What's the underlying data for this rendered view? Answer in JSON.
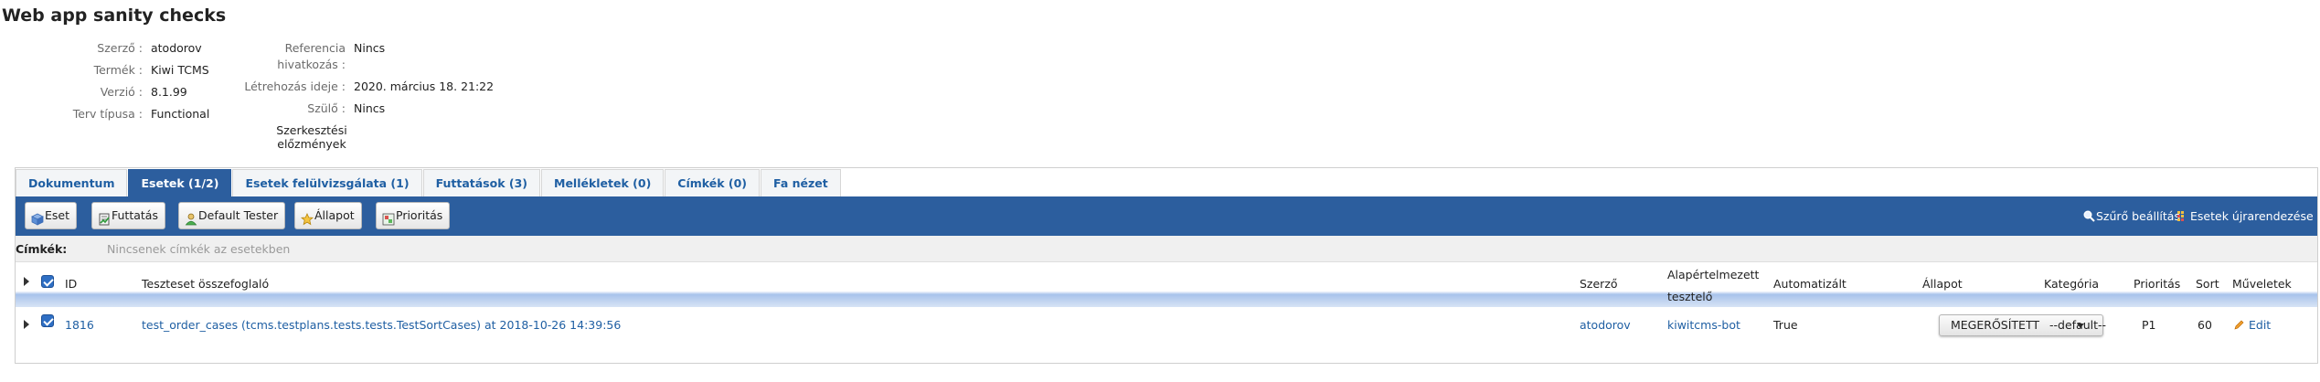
{
  "plan": {
    "title": "Web app sanity checks"
  },
  "meta": {
    "author_label": "Szerző :",
    "author_value": "atodorov",
    "product_label": "Termék :",
    "product_value": "Kiwi TCMS",
    "version_label": "Verzió :",
    "version_value": "8.1.99",
    "plan_type_label": "Terv típusa :",
    "plan_type_value": "Functional",
    "reference_label_1": "Referencia",
    "reference_label_2": "hivatkozás :",
    "reference_value": "Nincs",
    "created_label": "Létrehozás ideje :",
    "created_value": "2020. március 18. 21:22",
    "parent_label": "Szülő :",
    "parent_value": "Nincs",
    "history_link_1": "Szerkesztési",
    "history_link_2": "előzmények"
  },
  "tabs": [
    {
      "label": "Dokumentum",
      "active": false
    },
    {
      "label": "Esetek (1/2)",
      "active": true
    },
    {
      "label": "Esetek felülvizsgálata (1)",
      "active": false
    },
    {
      "label": "Futtatások (3)",
      "active": false
    },
    {
      "label": "Mellékletek (0)",
      "active": false
    },
    {
      "label": "Címkék (0)",
      "active": false
    },
    {
      "label": "Fa nézet",
      "active": false
    }
  ],
  "toolbar": {
    "case_button": "Eset",
    "run_button": "Futtatás",
    "tester_button": "Default Tester",
    "status_button": "Állapot",
    "priority_button": "Prioritás",
    "filter_link": "Szűrő beállítás",
    "reorder_link": "Esetek újrarendezése"
  },
  "tags": {
    "label": "Címkék:",
    "empty_text": "Nincsenek címkék az esetekben"
  },
  "table": {
    "headers": {
      "id": "ID",
      "summary": "Teszteset összefoglaló",
      "author": "Szerző",
      "default_tester_1": "Alapértelmezett",
      "default_tester_2": "tesztelő",
      "automated": "Automatizált",
      "status": "Állapot",
      "category": "Kategória",
      "priority": "Prioritás",
      "sort": "Sort",
      "actions": "Műveletek"
    },
    "rows": [
      {
        "id": "1816",
        "summary": "test_order_cases (tcms.testplans.tests.tests.TestSortCases) at 2018-10-26 14:39:56",
        "author": "atodorov",
        "default_tester": "kiwitcms-bot",
        "automated": "True",
        "status": "MEGERŐSÍTETT",
        "category": "--default--",
        "priority": "P1",
        "sort": "60",
        "action": "Edit"
      }
    ]
  },
  "colors": {
    "accent": "#2c5e9e",
    "link": "#1f5fa3"
  }
}
